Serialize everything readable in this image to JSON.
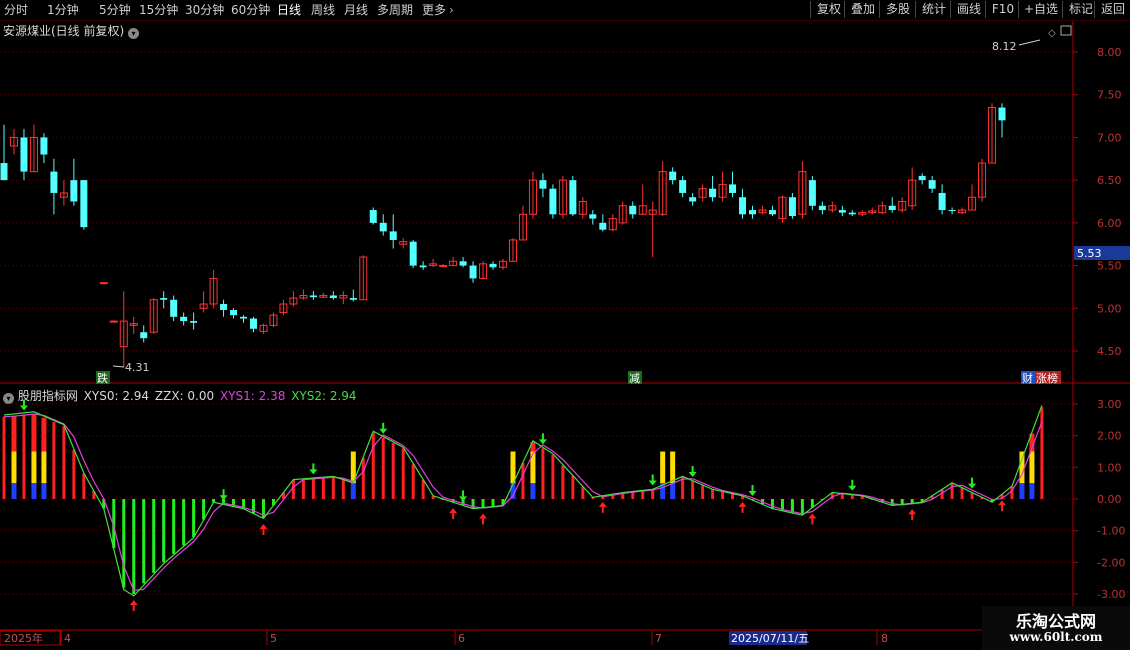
{
  "toolbar": {
    "periods": [
      "分时",
      "1分钟",
      "5分钟",
      "15分钟",
      "30分钟",
      "60分钟",
      "日线",
      "周线",
      "月线",
      "多周期",
      "更多"
    ],
    "active_period": "日线",
    "right_buttons": [
      "复权",
      "叠加",
      "多股",
      "统计",
      "画线",
      "F10",
      "+自选",
      "返回"
    ]
  },
  "main_chart": {
    "title": "安源煤业(日线 前复权)",
    "price_axis": [
      "8.00",
      "7.50",
      "7.00",
      "6.50",
      "6.00",
      "5.50",
      "5.00",
      "4.50"
    ],
    "current_price_tag": "5.53",
    "high_label": "8.12",
    "low_label": "4.31",
    "markers": [
      "跌",
      "减",
      "财",
      "涨榜"
    ]
  },
  "indicator": {
    "name": "股朋指标网",
    "values": [
      {
        "label": "XYS0: 2.94",
        "color": "#e0e0e0"
      },
      {
        "label": "ZZX: 0.00",
        "color": "#e0e0e0"
      },
      {
        "label": "XYS1: 2.38",
        "color": "#e040e0"
      },
      {
        "label": "XYS2: 2.94",
        "color": "#40e040"
      }
    ],
    "axis": [
      "3.00",
      "2.00",
      "1.00",
      "0.00",
      "-1.00",
      "-2.00",
      "-3.00"
    ]
  },
  "time_axis": {
    "labels": [
      "2025年",
      "4",
      "5",
      "6",
      "7",
      "8"
    ],
    "cursor_date": "2025/07/11/五"
  },
  "watermark": {
    "line1": "乐淘公式网",
    "line2": "www.60lt.com"
  },
  "colors": {
    "up": "#ff3333",
    "down": "#54ffff",
    "bg": "#000000",
    "grid": "#6e0000",
    "axis": "#b00000"
  }
}
